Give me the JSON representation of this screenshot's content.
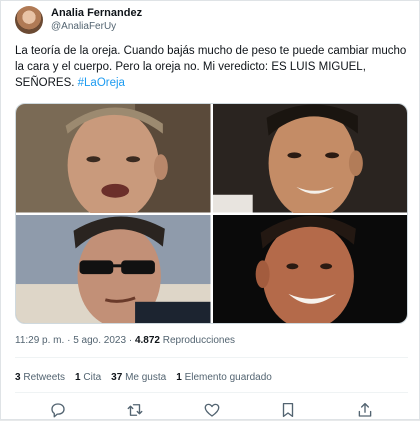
{
  "author": {
    "display_name": "Analia Fernandez",
    "handle": "@AnaliaFerUy"
  },
  "tweet": {
    "text": "La teoría de la oreja. Cuando bajás mucho de peso te puede cambiar mucho la cara y el cuerpo. Pero la oreja no. Mi veredicto: ES LUIS MIGUEL, SEÑORES.",
    "hashtag": "#LaOreja"
  },
  "media": {
    "photos": [
      "face-photo-1",
      "face-photo-2",
      "face-photo-3",
      "face-photo-4"
    ]
  },
  "meta": {
    "time": "11:29 p. m.",
    "separator": "·",
    "date": "5 ago. 2023",
    "views_count": "4.872",
    "views_label": "Reproducciones"
  },
  "stats": {
    "retweets_count": "3",
    "retweets_label": "Retweets",
    "quotes_count": "1",
    "quotes_label": "Cita",
    "likes_count": "37",
    "likes_label": "Me gusta",
    "bookmarks_count": "1",
    "bookmarks_label": "Elemento guardado"
  },
  "actions": [
    "reply-icon",
    "retweet-icon",
    "like-icon",
    "bookmark-icon",
    "share-icon"
  ],
  "colors": {
    "link": "#1d9bf0",
    "text": "#0f1419",
    "muted": "#536471",
    "border": "#cfd9de"
  }
}
